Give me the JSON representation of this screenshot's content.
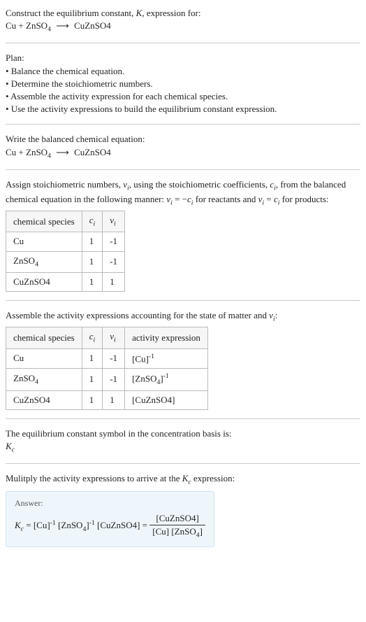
{
  "header": {
    "line1": "Construct the equilibrium constant, K, expression for:",
    "equation_plain": "Cu + ZnSO₄  ⟶  CuZnSO4"
  },
  "plan": {
    "title": "Plan:",
    "items": [
      "• Balance the chemical equation.",
      "• Determine the stoichiometric numbers.",
      "• Assemble the activity expression for each chemical species.",
      "• Use the activity expressions to build the equilibrium constant expression."
    ]
  },
  "balanced": {
    "title": "Write the balanced chemical equation:",
    "equation_plain": "Cu + ZnSO₄  ⟶  CuZnSO4"
  },
  "stoich": {
    "intro": "Assign stoichiometric numbers, νᵢ, using the stoichiometric coefficients, cᵢ, from the balanced chemical equation in the following manner: νᵢ = −cᵢ for reactants and νᵢ = cᵢ for products:",
    "headers": {
      "species": "chemical species",
      "c": "cᵢ",
      "nu": "νᵢ"
    },
    "rows": [
      {
        "species": "Cu",
        "c": "1",
        "nu": "-1"
      },
      {
        "species": "ZnSO₄",
        "c": "1",
        "nu": "-1"
      },
      {
        "species": "CuZnSO4",
        "c": "1",
        "nu": "1"
      }
    ]
  },
  "activity": {
    "intro": "Assemble the activity expressions accounting for the state of matter and νᵢ:",
    "headers": {
      "species": "chemical species",
      "c": "cᵢ",
      "nu": "νᵢ",
      "expr": "activity expression"
    },
    "rows": [
      {
        "species": "Cu",
        "c": "1",
        "nu": "-1",
        "expr": "[Cu]⁻¹"
      },
      {
        "species": "ZnSO₄",
        "c": "1",
        "nu": "-1",
        "expr": "[ZnSO₄]⁻¹"
      },
      {
        "species": "CuZnSO4",
        "c": "1",
        "nu": "1",
        "expr": "[CuZnSO4]"
      }
    ]
  },
  "symbol": {
    "line": "The equilibrium constant symbol in the concentration basis is:",
    "kc": "K𝑐"
  },
  "multiply": {
    "line": "Mulitply the activity expressions to arrive at the K𝑐 expression:"
  },
  "answer": {
    "label": "Answer:",
    "lhs": "K𝑐 = [Cu]⁻¹ [ZnSO₄]⁻¹ [CuZnSO4] =",
    "frac_top": "[CuZnSO4]",
    "frac_bot": "[Cu] [ZnSO₄]"
  },
  "chart_data": {
    "type": "table",
    "tables": [
      {
        "title": "Stoichiometric numbers",
        "columns": [
          "chemical species",
          "c_i",
          "nu_i"
        ],
        "rows": [
          [
            "Cu",
            1,
            -1
          ],
          [
            "ZnSO4",
            1,
            -1
          ],
          [
            "CuZnSO4",
            1,
            1
          ]
        ]
      },
      {
        "title": "Activity expressions",
        "columns": [
          "chemical species",
          "c_i",
          "nu_i",
          "activity expression"
        ],
        "rows": [
          [
            "Cu",
            1,
            -1,
            "[Cu]^-1"
          ],
          [
            "ZnSO4",
            1,
            -1,
            "[ZnSO4]^-1"
          ],
          [
            "CuZnSO4",
            1,
            1,
            "[CuZnSO4]"
          ]
        ]
      }
    ]
  }
}
